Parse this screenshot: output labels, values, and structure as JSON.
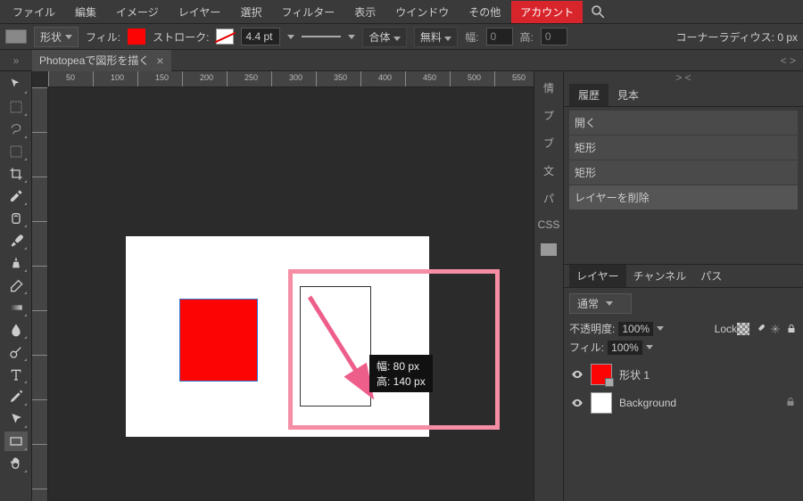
{
  "menu": {
    "file": "ファイル",
    "edit": "編集",
    "image": "イメージ",
    "layer": "レイヤー",
    "select": "選択",
    "filter": "フィルター",
    "view": "表示",
    "window": "ウインドウ",
    "other": "その他",
    "account": "アカウント"
  },
  "opts": {
    "shape": "形状",
    "fill": "フィル:",
    "stroke": "ストローク:",
    "pt": "4.4 pt",
    "combine": "合体",
    "free": "無料",
    "wlbl": "幅:",
    "wval": "0",
    "hlbl": "高:",
    "hval": "0",
    "corner": "コーナーラディウス: 0 px"
  },
  "tab": {
    "title": "Photopeaで図形を描く",
    "close": "×",
    "expand": "< >",
    "rexpand": "> <"
  },
  "ruler": {
    "m1": "50",
    "m2": "100",
    "m3": "150",
    "m4": "200",
    "m5": "250",
    "m6": "300",
    "m7": "350",
    "m8": "400",
    "m9": "450",
    "m10": "500",
    "m11": "550"
  },
  "tip": {
    "w": "幅: 80 px",
    "h": "高: 140 px"
  },
  "vtabs": {
    "a": "情",
    "b": "プ",
    "c": "ブ",
    "d": "文",
    "e": "パ",
    "f": "CSS"
  },
  "hist": {
    "tab1": "履歴",
    "tab2": "見本",
    "i1": "開く",
    "i2": "矩形",
    "i3": "矩形",
    "i4": "レイヤーを削除"
  },
  "lyr": {
    "tab1": "レイヤー",
    "tab2": "チャンネル",
    "tab3": "パス",
    "blend": "通常",
    "opac": "不透明度:",
    "opv": "100%",
    "lock": "Lock:",
    "fill": "フィル:",
    "fv": "100%",
    "l1": "形状 1",
    "l2": "Background"
  }
}
